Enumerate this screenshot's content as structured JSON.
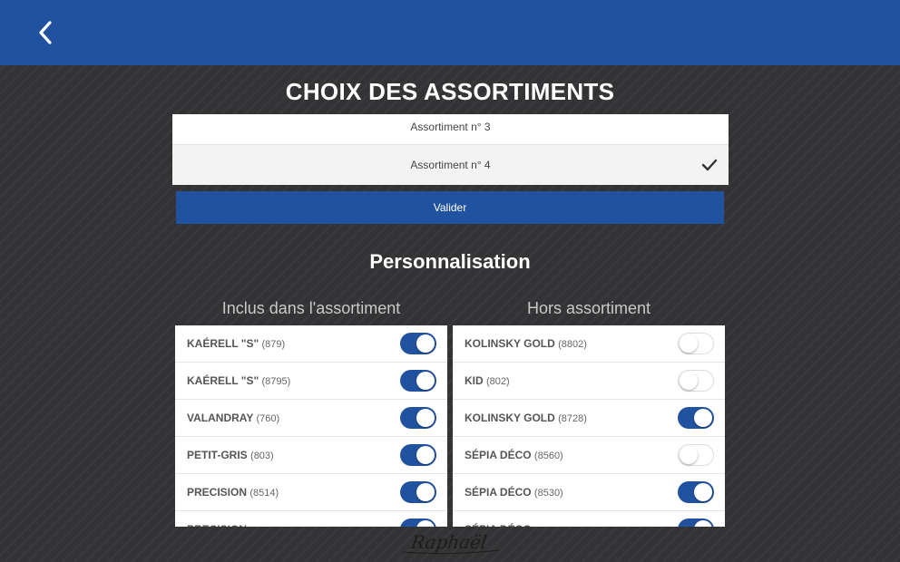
{
  "header": {
    "back_icon": "chevron-left-icon"
  },
  "page": {
    "title": "CHOIX DES ASSORTIMENTS"
  },
  "assortments": [
    {
      "label": "Assortiment n° 3",
      "selected": false
    },
    {
      "label": "Assortiment n° 4",
      "selected": true
    }
  ],
  "validate": {
    "label": "Valider"
  },
  "personalisation": {
    "title": "Personnalisation",
    "included": {
      "title": "Inclus dans l'assortiment",
      "items": [
        {
          "name": "KAÉRELL \"S\"",
          "code": "(879)",
          "enabled": true
        },
        {
          "name": "KAÉRELL \"S\"",
          "code": "(8795)",
          "enabled": true
        },
        {
          "name": "VALANDRAY",
          "code": "(760)",
          "enabled": true
        },
        {
          "name": "PETIT-GRIS",
          "code": "(803)",
          "enabled": true
        },
        {
          "name": "PRECISION",
          "code": "(8514)",
          "enabled": true
        },
        {
          "name": "PRECISION",
          "code": "",
          "enabled": true
        }
      ]
    },
    "excluded": {
      "title": "Hors assortiment",
      "items": [
        {
          "name": "KOLINSKY GOLD",
          "code": "(8802)",
          "enabled": false
        },
        {
          "name": "KID",
          "code": "(802)",
          "enabled": false
        },
        {
          "name": "KOLINSKY GOLD",
          "code": "(8728)",
          "enabled": true
        },
        {
          "name": "SÉPIA DÉCO",
          "code": "(8560)",
          "enabled": false
        },
        {
          "name": "SÉPIA DÉCO",
          "code": "(8530)",
          "enabled": true
        },
        {
          "name": "SÉPIA DÉCO",
          "code": "",
          "enabled": true
        }
      ]
    }
  },
  "brand": {
    "logo": "Raphaël"
  },
  "colors": {
    "primary": "#2152a0",
    "background": "#333335"
  }
}
